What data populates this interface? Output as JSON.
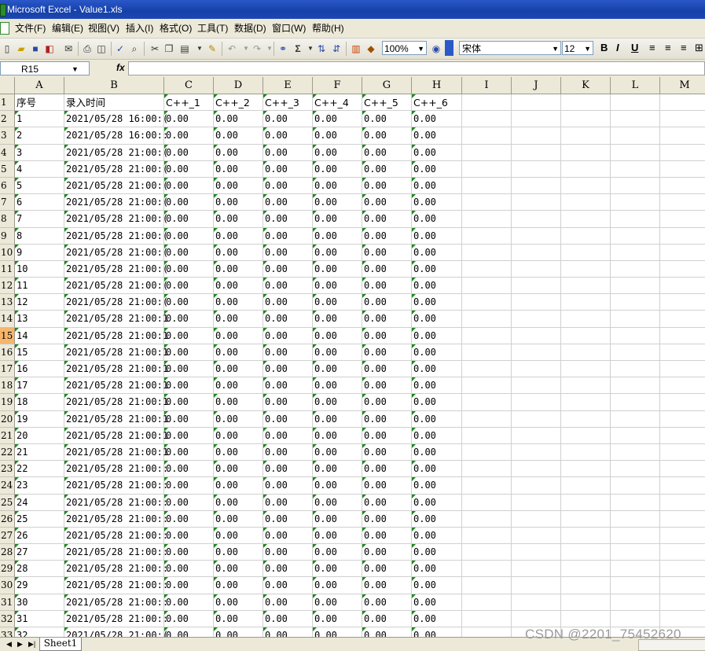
{
  "window": {
    "title": "Microsoft Excel - Value1.xls"
  },
  "menu": [
    "文件(F)",
    "编辑(E)",
    "视图(V)",
    "插入(I)",
    "格式(O)",
    "工具(T)",
    "数据(D)",
    "窗口(W)",
    "帮助(H)"
  ],
  "toolbar": {
    "zoom": "100%",
    "font_name": "宋体",
    "font_size": "12",
    "bold": "B",
    "italic": "I",
    "underline": "U",
    "sum": "Σ"
  },
  "formula_bar": {
    "name_box": "R15",
    "fx": "fx"
  },
  "columns": [
    "A",
    "B",
    "C",
    "D",
    "E",
    "F",
    "G",
    "H",
    "I",
    "J",
    "K",
    "L",
    "M"
  ],
  "header_row": [
    "序号",
    "录入时间",
    "C++_1",
    "C++_2",
    "C++_3",
    "C++_4",
    "C++_5",
    "C++_6"
  ],
  "data_rows": [
    {
      "row": "2",
      "id": "1",
      "time": "2021/05/28 16:00:(",
      "vals": [
        "0.00",
        "0.00",
        "0.00",
        "0.00",
        "0.00",
        "0.00"
      ]
    },
    {
      "row": "3",
      "id": "2",
      "time": "2021/05/28 16:00::",
      "vals": [
        "0.00",
        "0.00",
        "0.00",
        "0.00",
        "0.00",
        "0.00"
      ]
    },
    {
      "row": "4",
      "id": "3",
      "time": "2021/05/28 21:00:(",
      "vals": [
        "0.00",
        "0.00",
        "0.00",
        "0.00",
        "0.00",
        "0.00"
      ]
    },
    {
      "row": "5",
      "id": "4",
      "time": "2021/05/28 21:00:(",
      "vals": [
        "0.00",
        "0.00",
        "0.00",
        "0.00",
        "0.00",
        "0.00"
      ]
    },
    {
      "row": "6",
      "id": "5",
      "time": "2021/05/28 21:00:(",
      "vals": [
        "0.00",
        "0.00",
        "0.00",
        "0.00",
        "0.00",
        "0.00"
      ]
    },
    {
      "row": "7",
      "id": "6",
      "time": "2021/05/28 21:00:(",
      "vals": [
        "0.00",
        "0.00",
        "0.00",
        "0.00",
        "0.00",
        "0.00"
      ]
    },
    {
      "row": "8",
      "id": "7",
      "time": "2021/05/28 21:00:(",
      "vals": [
        "0.00",
        "0.00",
        "0.00",
        "0.00",
        "0.00",
        "0.00"
      ]
    },
    {
      "row": "9",
      "id": "8",
      "time": "2021/05/28 21:00:(",
      "vals": [
        "0.00",
        "0.00",
        "0.00",
        "0.00",
        "0.00",
        "0.00"
      ]
    },
    {
      "row": "10",
      "id": "9",
      "time": "2021/05/28 21:00:(",
      "vals": [
        "0.00",
        "0.00",
        "0.00",
        "0.00",
        "0.00",
        "0.00"
      ]
    },
    {
      "row": "11",
      "id": "10",
      "time": "2021/05/28 21:00:(",
      "vals": [
        "0.00",
        "0.00",
        "0.00",
        "0.00",
        "0.00",
        "0.00"
      ]
    },
    {
      "row": "12",
      "id": "11",
      "time": "2021/05/28 21:00:(",
      "vals": [
        "0.00",
        "0.00",
        "0.00",
        "0.00",
        "0.00",
        "0.00"
      ]
    },
    {
      "row": "13",
      "id": "12",
      "time": "2021/05/28 21:00:(",
      "vals": [
        "0.00",
        "0.00",
        "0.00",
        "0.00",
        "0.00",
        "0.00"
      ]
    },
    {
      "row": "14",
      "id": "13",
      "time": "2021/05/28 21:00:1",
      "vals": [
        "0.00",
        "0.00",
        "0.00",
        "0.00",
        "0.00",
        "0.00"
      ]
    },
    {
      "row": "15",
      "id": "14",
      "time": "2021/05/28 21:00:1",
      "vals": [
        "0.00",
        "0.00",
        "0.00",
        "0.00",
        "0.00",
        "0.00"
      ]
    },
    {
      "row": "16",
      "id": "15",
      "time": "2021/05/28 21:00:1",
      "vals": [
        "0.00",
        "0.00",
        "0.00",
        "0.00",
        "0.00",
        "0.00"
      ]
    },
    {
      "row": "17",
      "id": "16",
      "time": "2021/05/28 21:00:1",
      "vals": [
        "0.00",
        "0.00",
        "0.00",
        "0.00",
        "0.00",
        "0.00"
      ]
    },
    {
      "row": "18",
      "id": "17",
      "time": "2021/05/28 21:00:1",
      "vals": [
        "0.00",
        "0.00",
        "0.00",
        "0.00",
        "0.00",
        "0.00"
      ]
    },
    {
      "row": "19",
      "id": "18",
      "time": "2021/05/28 21:00:1",
      "vals": [
        "0.00",
        "0.00",
        "0.00",
        "0.00",
        "0.00",
        "0.00"
      ]
    },
    {
      "row": "20",
      "id": "19",
      "time": "2021/05/28 21:00:1",
      "vals": [
        "0.00",
        "0.00",
        "0.00",
        "0.00",
        "0.00",
        "0.00"
      ]
    },
    {
      "row": "21",
      "id": "20",
      "time": "2021/05/28 21:00:1",
      "vals": [
        "0.00",
        "0.00",
        "0.00",
        "0.00",
        "0.00",
        "0.00"
      ]
    },
    {
      "row": "22",
      "id": "21",
      "time": "2021/05/28 21:00:1",
      "vals": [
        "0.00",
        "0.00",
        "0.00",
        "0.00",
        "0.00",
        "0.00"
      ]
    },
    {
      "row": "23",
      "id": "22",
      "time": "2021/05/28 21:00::",
      "vals": [
        "0.00",
        "0.00",
        "0.00",
        "0.00",
        "0.00",
        "0.00"
      ]
    },
    {
      "row": "24",
      "id": "23",
      "time": "2021/05/28 21:00::",
      "vals": [
        "0.00",
        "0.00",
        "0.00",
        "0.00",
        "0.00",
        "0.00"
      ]
    },
    {
      "row": "25",
      "id": "24",
      "time": "2021/05/28 21:00::",
      "vals": [
        "0.00",
        "0.00",
        "0.00",
        "0.00",
        "0.00",
        "0.00"
      ]
    },
    {
      "row": "26",
      "id": "25",
      "time": "2021/05/28 21:00::",
      "vals": [
        "0.00",
        "0.00",
        "0.00",
        "0.00",
        "0.00",
        "0.00"
      ]
    },
    {
      "row": "27",
      "id": "26",
      "time": "2021/05/28 21:00::",
      "vals": [
        "0.00",
        "0.00",
        "0.00",
        "0.00",
        "0.00",
        "0.00"
      ]
    },
    {
      "row": "28",
      "id": "27",
      "time": "2021/05/28 21:00::",
      "vals": [
        "0.00",
        "0.00",
        "0.00",
        "0.00",
        "0.00",
        "0.00"
      ]
    },
    {
      "row": "29",
      "id": "28",
      "time": "2021/05/28 21:00::",
      "vals": [
        "0.00",
        "0.00",
        "0.00",
        "0.00",
        "0.00",
        "0.00"
      ]
    },
    {
      "row": "30",
      "id": "29",
      "time": "2021/05/28 21:00::",
      "vals": [
        "0.00",
        "0.00",
        "0.00",
        "0.00",
        "0.00",
        "0.00"
      ]
    },
    {
      "row": "31",
      "id": "30",
      "time": "2021/05/28 21:00::",
      "vals": [
        "0.00",
        "0.00",
        "0.00",
        "0.00",
        "0.00",
        "0.00"
      ]
    },
    {
      "row": "32",
      "id": "31",
      "time": "2021/05/28 21:00::",
      "vals": [
        "0.00",
        "0.00",
        "0.00",
        "0.00",
        "0.00",
        "0.00"
      ]
    },
    {
      "row": "33",
      "id": "32",
      "time": "2021/05/28 21:00:(",
      "vals": [
        "0.00",
        "0.00",
        "0.00",
        "0.00",
        "0.00",
        "0.00"
      ]
    }
  ],
  "active_row": "15",
  "sheet_tab": "Sheet1",
  "watermark": "CSDN @2201_75452620",
  "colors": {
    "title_bar": "#1540a8",
    "chrome": "#ece9d8",
    "active_row_header": "#f7b56a",
    "error_indicator": "#1a8a1a"
  }
}
